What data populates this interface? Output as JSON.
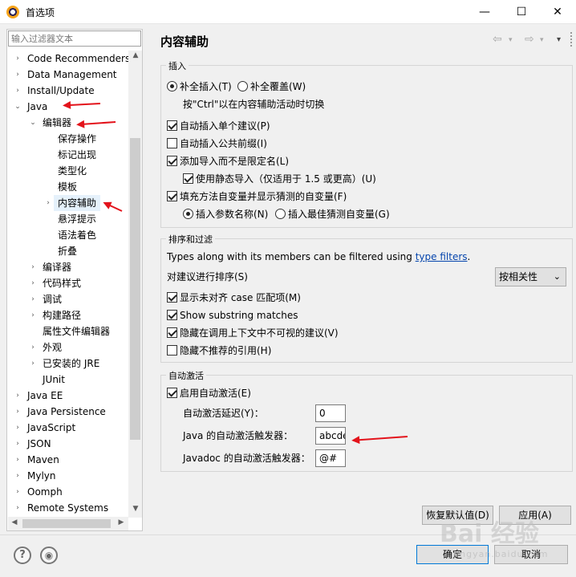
{
  "window": {
    "title": "首选项",
    "minimize": "—",
    "maximize": "☐",
    "close": "✕"
  },
  "filter": {
    "placeholder": "输入过滤器文本"
  },
  "tree": [
    {
      "label": "Code Recommenders",
      "level": 0,
      "twisty": "›"
    },
    {
      "label": "Data Management",
      "level": 0,
      "twisty": "›"
    },
    {
      "label": "Install/Update",
      "level": 0,
      "twisty": "›"
    },
    {
      "label": "Java",
      "level": 0,
      "twisty": "⌄"
    },
    {
      "label": "编辑器",
      "level": 1,
      "twisty": "⌄"
    },
    {
      "label": "保存操作",
      "level": 2,
      "twisty": ""
    },
    {
      "label": "标记出现",
      "level": 2,
      "twisty": ""
    },
    {
      "label": "类型化",
      "level": 2,
      "twisty": ""
    },
    {
      "label": "模板",
      "level": 2,
      "twisty": ""
    },
    {
      "label": "内容辅助",
      "level": 2,
      "twisty": "›"
    },
    {
      "label": "悬浮提示",
      "level": 2,
      "twisty": ""
    },
    {
      "label": "语法着色",
      "level": 2,
      "twisty": ""
    },
    {
      "label": "折叠",
      "level": 2,
      "twisty": ""
    },
    {
      "label": "编译器",
      "level": 1,
      "twisty": "›"
    },
    {
      "label": "代码样式",
      "level": 1,
      "twisty": "›"
    },
    {
      "label": "调试",
      "level": 1,
      "twisty": "›"
    },
    {
      "label": "构建路径",
      "level": 1,
      "twisty": "›"
    },
    {
      "label": "属性文件编辑器",
      "level": 1,
      "twisty": ""
    },
    {
      "label": "外观",
      "level": 1,
      "twisty": "›"
    },
    {
      "label": "已安装的 JRE",
      "level": 1,
      "twisty": "›"
    },
    {
      "label": "JUnit",
      "level": 1,
      "twisty": ""
    },
    {
      "label": "Java EE",
      "level": 0,
      "twisty": "›"
    },
    {
      "label": "Java Persistence",
      "level": 0,
      "twisty": "›"
    },
    {
      "label": "JavaScript",
      "level": 0,
      "twisty": "›"
    },
    {
      "label": "JSON",
      "level": 0,
      "twisty": "›"
    },
    {
      "label": "Maven",
      "level": 0,
      "twisty": "›"
    },
    {
      "label": "Mylyn",
      "level": 0,
      "twisty": "›"
    },
    {
      "label": "Oomph",
      "level": 0,
      "twisty": "›"
    },
    {
      "label": "Remote Systems",
      "level": 0,
      "twisty": "›"
    }
  ],
  "page": {
    "title": "内容辅助",
    "nav_back": "⇦",
    "nav_forward": "⇨",
    "nav_menu": "▾"
  },
  "insert": {
    "title": "插入",
    "radio_complete": "补全插入(T)",
    "radio_overwrite": "补全覆盖(W)",
    "hint": "按\"Ctrl\"以在内容辅助活动时切换",
    "auto_single": "自动插入单个建议(P)",
    "auto_prefix": "自动插入公共前缀(I)",
    "add_import": "添加导入而不是限定名(L)",
    "static_import": "使用静态导入（仅适用于 1.5 或更高）(U)",
    "fill_args": "填充方法自变量并显示猜测的自变量(F)",
    "insert_param_names": "插入参数名称(N)",
    "insert_best_guess": "插入最佳猜测自变量(G)"
  },
  "sorting": {
    "title": "排序和过滤",
    "types_text": "Types along with its members can be filtered using ",
    "types_link": "type filters",
    "types_end": ".",
    "sort_label": "对建议进行排序(S)",
    "sort_value": "按相关性",
    "show_camel": "显示未对齐 case 匹配项(M)",
    "show_substring": "Show substring matches",
    "hide_invisible": "隐藏在调用上下文中不可视的建议(V)",
    "hide_deprecated": "隐藏不推荐的引用(H)"
  },
  "auto": {
    "title": "自动激活",
    "enable": "启用自动激活(E)",
    "delay_label": "自动激活延迟(Y)：",
    "delay_value": "0",
    "java_trigger_label": "Java 的自动激活触发器：",
    "java_trigger_value": "abcde",
    "javadoc_trigger_label": "Javadoc 的自动激活触发器：",
    "javadoc_trigger_value": "@#"
  },
  "buttons": {
    "restore_defaults": "恢复默认值(D)",
    "apply": "应用(A)",
    "ok": "确定",
    "cancel": "取消"
  },
  "footer": {
    "help": "?",
    "import_export": "◉"
  },
  "watermark": {
    "main": "Bai 经验",
    "sub": "jingyan.baidu.com"
  },
  "colors": {
    "annotation_arrow": "#e3131b",
    "selection": "#e5f1fb",
    "link": "#0645ad"
  }
}
